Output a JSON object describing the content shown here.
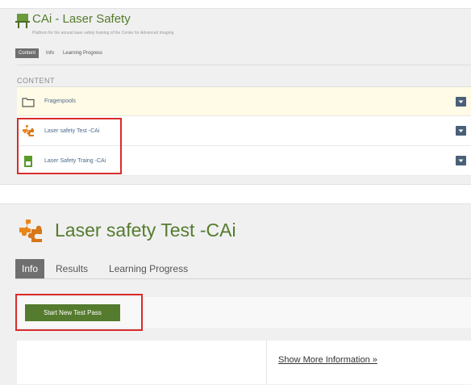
{
  "top": {
    "title": "CAi - Laser Safety",
    "subtitle": "Platform for the annual laser safety training of the Center for Advanced Imaging",
    "tabs": [
      {
        "label": "Content",
        "active": true
      },
      {
        "label": "Info",
        "active": false
      },
      {
        "label": "Learning Progress",
        "active": false
      }
    ],
    "section_label": "CONTENT",
    "items": [
      {
        "label": "Fragenpools",
        "icon": "folder-icon"
      },
      {
        "label": "Laser safety Test -CAi",
        "icon": "test-puzzle-icon"
      },
      {
        "label": "Laser Safety Traing -CAi",
        "icon": "learning-module-icon"
      }
    ]
  },
  "bottom": {
    "title": "Laser safety Test -CAi",
    "tabs": [
      {
        "label": "Info",
        "active": true
      },
      {
        "label": "Results",
        "active": false
      },
      {
        "label": "Learning Progress",
        "active": false
      }
    ],
    "start_button_label": "Start New Test Pass",
    "more_info_link": "Show More Information »"
  },
  "colors": {
    "accent_green": "#557b2e",
    "highlight_red": "#d92b2b",
    "puzzle_orange": "#e8861a",
    "action_button": "#4a5f78"
  }
}
